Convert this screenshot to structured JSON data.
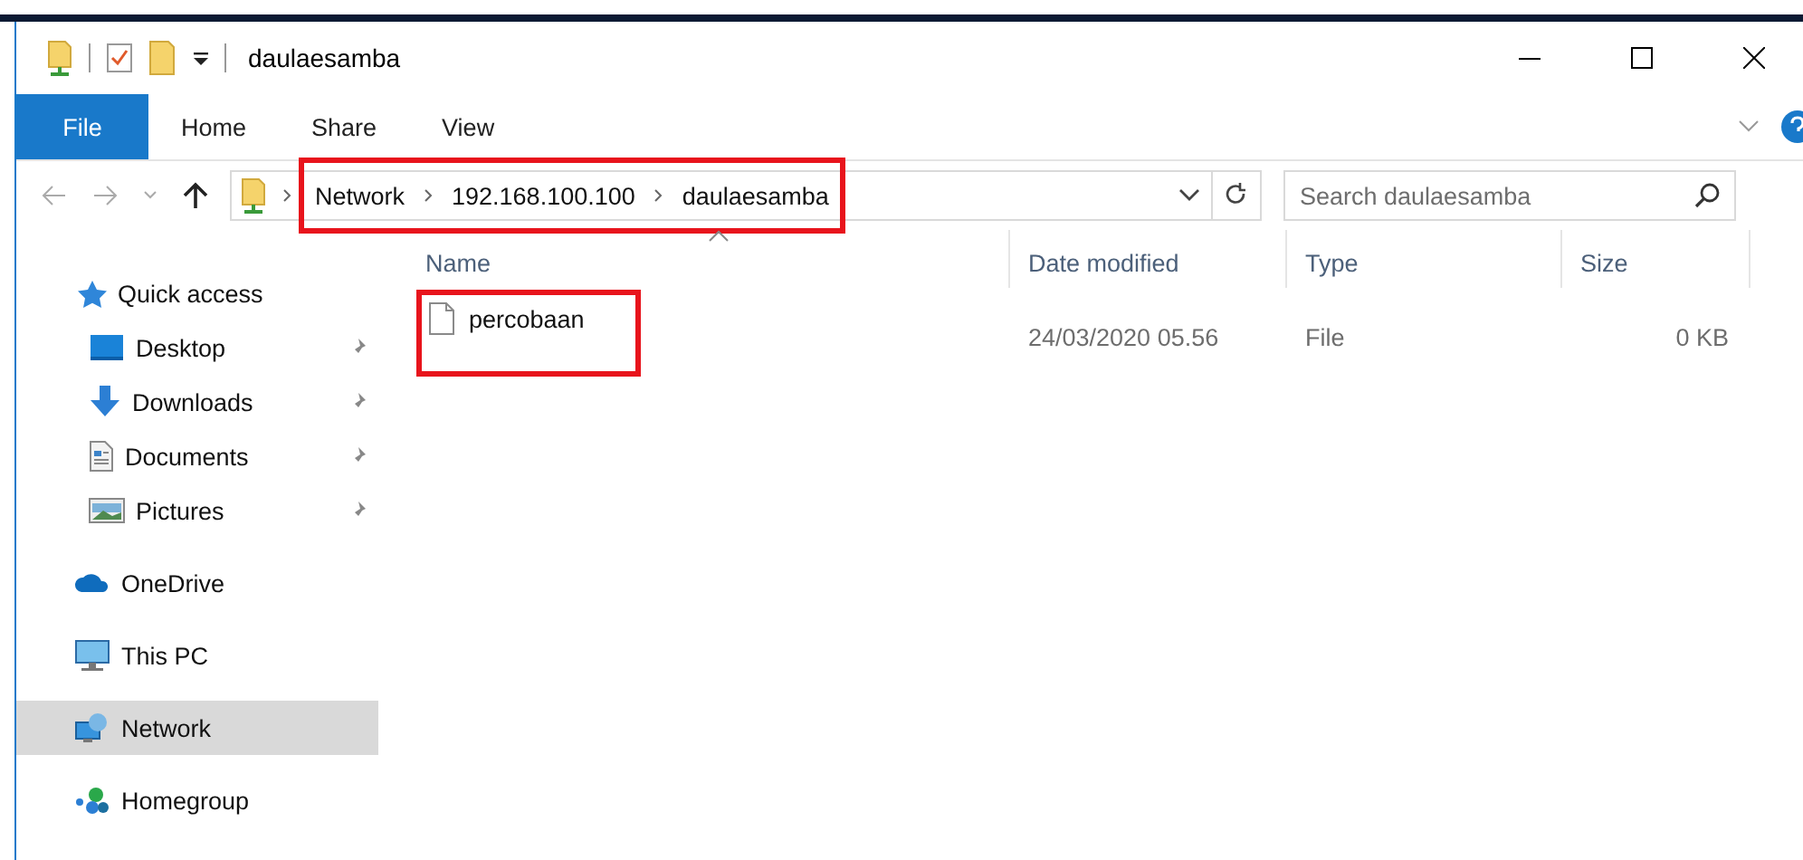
{
  "window": {
    "title": "daulaesamba"
  },
  "ribbon": {
    "tabs": [
      {
        "label": "File",
        "kind": "file",
        "selected": false
      },
      {
        "label": "Home",
        "kind": "tab",
        "selected": false
      },
      {
        "label": "Share",
        "kind": "tab",
        "selected": false
      },
      {
        "label": "View",
        "kind": "tab",
        "selected": false
      }
    ]
  },
  "address": {
    "breadcrumbs": [
      "Network",
      "192.168.100.100",
      "daulaesamba"
    ],
    "highlighted": true
  },
  "search": {
    "placeholder": "Search daulaesamba"
  },
  "navigation": [
    {
      "label": "Quick access",
      "selected": false,
      "children": [
        {
          "label": "Desktop",
          "pinned": true,
          "selected": false
        },
        {
          "label": "Downloads",
          "pinned": true,
          "selected": false
        },
        {
          "label": "Documents",
          "pinned": true,
          "selected": false
        },
        {
          "label": "Pictures",
          "pinned": true,
          "selected": false
        }
      ]
    },
    {
      "label": "OneDrive",
      "selected": false
    },
    {
      "label": "This PC",
      "selected": false
    },
    {
      "label": "Network",
      "selected": true
    },
    {
      "label": "Homegroup",
      "selected": false
    }
  ],
  "table": {
    "columns": [
      {
        "label": "Name",
        "sorted": true
      },
      {
        "label": "Date modified",
        "sorted": false
      },
      {
        "label": "Type",
        "sorted": false
      },
      {
        "label": "Size",
        "sorted": false
      }
    ],
    "rows": [
      {
        "name": "percobaan",
        "date_modified": "24/03/2020 05.56",
        "type": "File",
        "size": "0 KB",
        "highlighted": true
      }
    ]
  }
}
